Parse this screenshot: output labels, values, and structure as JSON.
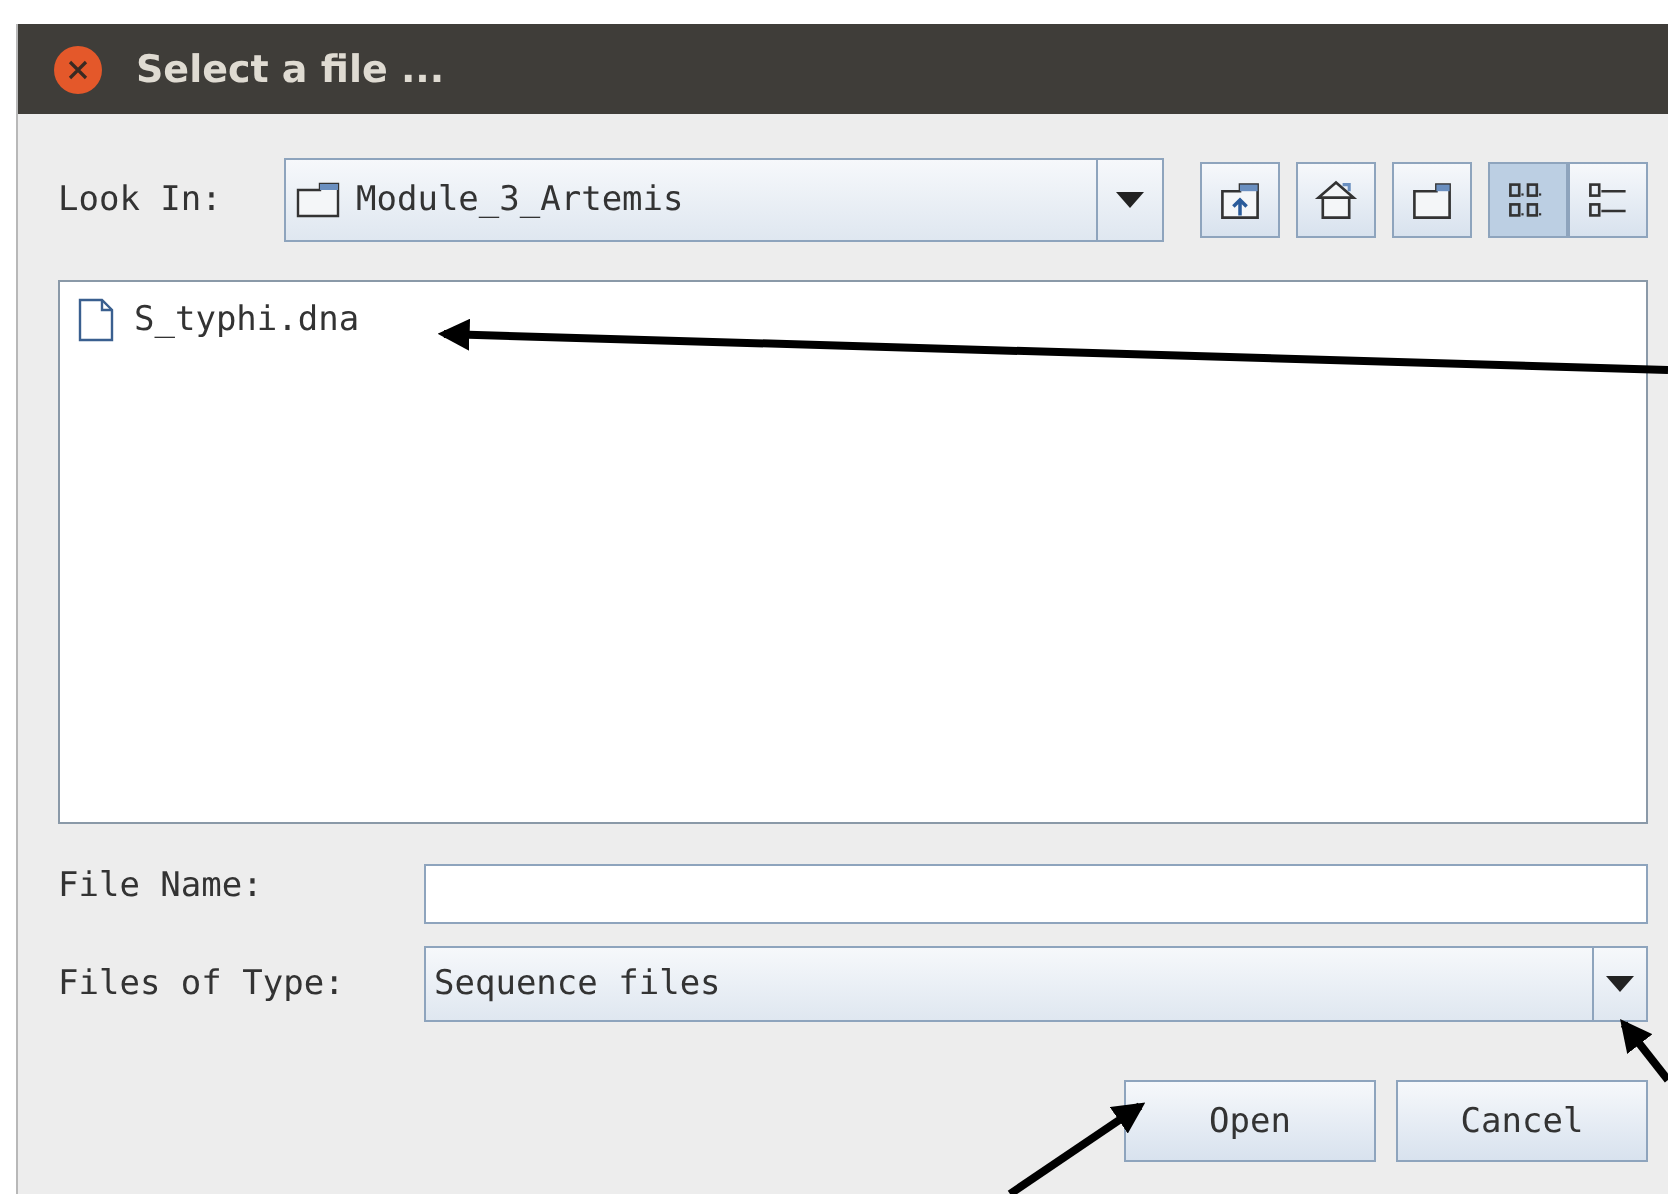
{
  "window": {
    "title": "Select a file ..."
  },
  "look_in": {
    "label": "Look In:",
    "value": "Module_3_Artemis"
  },
  "toolbar": [
    {
      "kind": "up",
      "selected": false
    },
    {
      "kind": "home",
      "selected": false
    },
    {
      "kind": "new-folder",
      "selected": false
    },
    {
      "kind": "list",
      "selected": true
    },
    {
      "kind": "details",
      "selected": false
    }
  ],
  "files": [
    {
      "name": "S_typhi.dna",
      "selected": false
    }
  ],
  "file_name": {
    "label": "File Name:"
  },
  "file_type": {
    "label": "Files of Type:",
    "value": "Sequence files"
  },
  "buttons": [
    {
      "label": "Open"
    },
    {
      "label": "Cancel"
    }
  ]
}
